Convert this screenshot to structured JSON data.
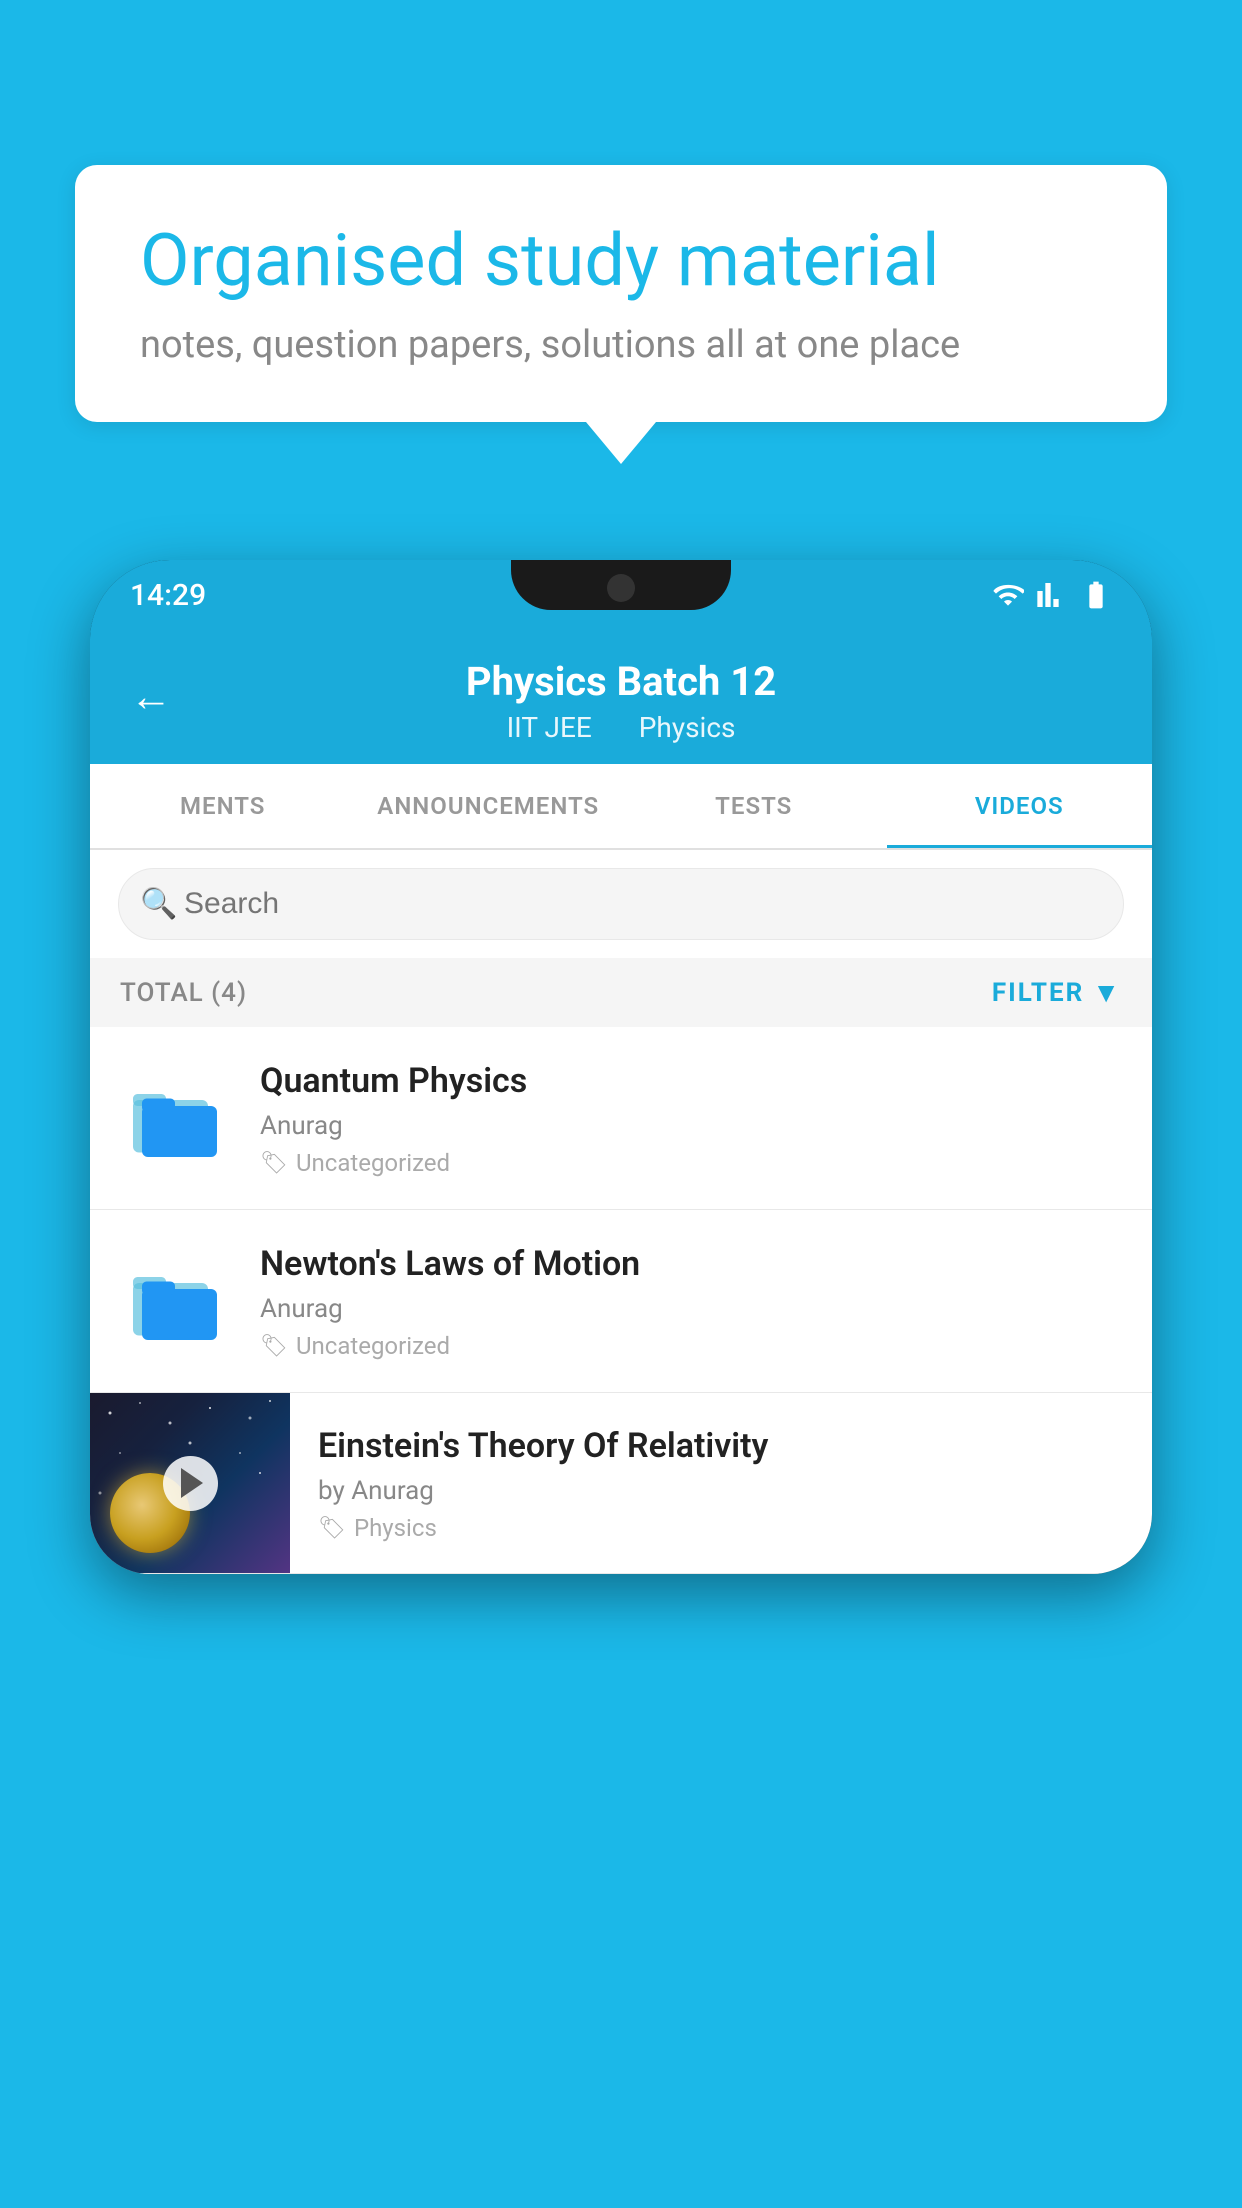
{
  "background": {
    "color": "#1bb8e8"
  },
  "speech_bubble": {
    "title": "Organised study material",
    "subtitle": "notes, question papers, solutions all at one place"
  },
  "phone": {
    "status_bar": {
      "time": "14:29",
      "wifi_icon": "wifi",
      "signal_icon": "signal",
      "battery_icon": "battery"
    },
    "header": {
      "back_label": "←",
      "title": "Physics Batch 12",
      "subtitle_part1": "IIT JEE",
      "subtitle_part2": "Physics"
    },
    "tabs": [
      {
        "label": "MENTS",
        "active": false
      },
      {
        "label": "ANNOUNCEMENTS",
        "active": false
      },
      {
        "label": "TESTS",
        "active": false
      },
      {
        "label": "VIDEOS",
        "active": true
      }
    ],
    "search": {
      "placeholder": "Search"
    },
    "filter_bar": {
      "total_label": "TOTAL (4)",
      "filter_label": "FILTER"
    },
    "videos": [
      {
        "id": 1,
        "title": "Quantum Physics",
        "author": "Anurag",
        "tag": "Uncategorized",
        "has_thumbnail": false
      },
      {
        "id": 2,
        "title": "Newton's Laws of Motion",
        "author": "Anurag",
        "tag": "Uncategorized",
        "has_thumbnail": false
      },
      {
        "id": 3,
        "title": "Einstein's Theory Of Relativity",
        "author": "by Anurag",
        "tag": "Physics",
        "has_thumbnail": true
      }
    ]
  }
}
